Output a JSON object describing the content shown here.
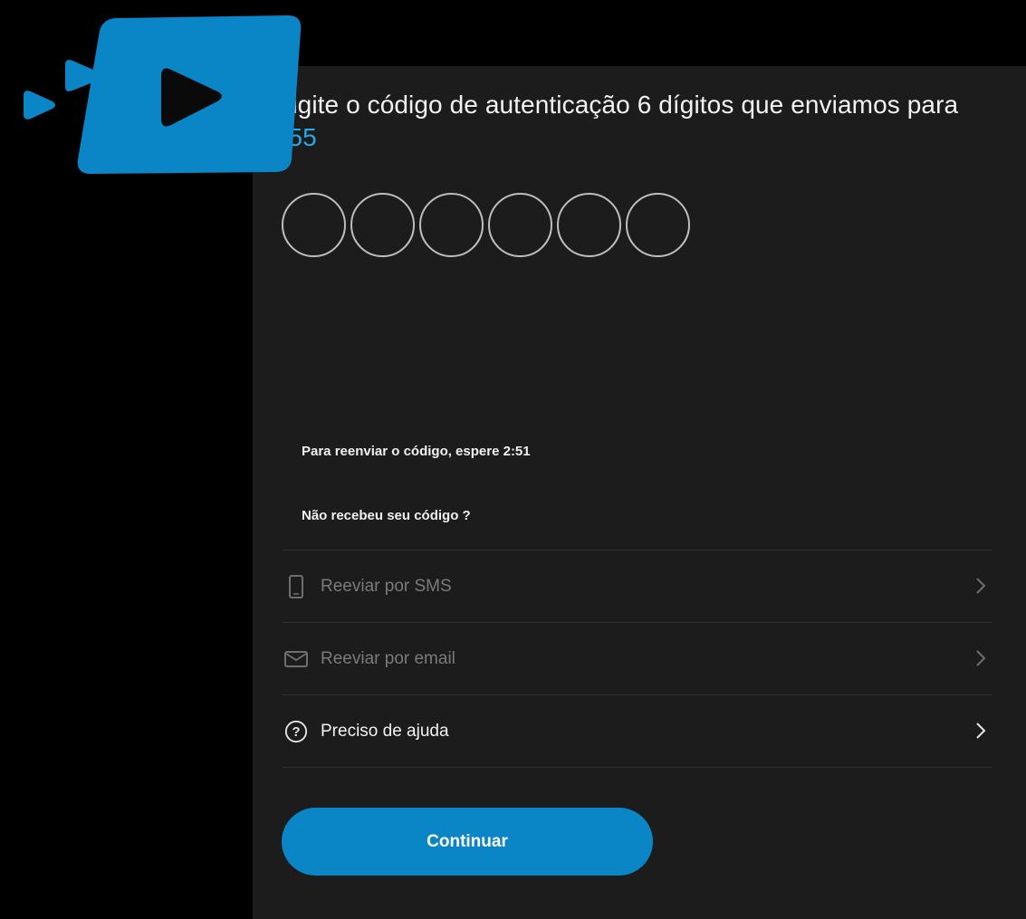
{
  "header": {
    "instruction_text": "Digite o código de autenticação 6 dígitos que enviamos para",
    "phone_prefix": "+55"
  },
  "code_input": {
    "digit_count": 6,
    "values": [
      "",
      "",
      "",
      "",
      "",
      ""
    ]
  },
  "resend": {
    "wait_label": "Para reenviar o código, espere 2:51",
    "not_received_label": "Não recebeu seu código ?"
  },
  "options": [
    {
      "label": "Reeviar por SMS",
      "icon": "phone-icon",
      "enabled": false
    },
    {
      "label": "Reeviar por email",
      "icon": "envelope-icon",
      "enabled": false
    },
    {
      "label": "Preciso de ajuda",
      "icon": "question-circle-icon",
      "enabled": true
    }
  ],
  "actions": {
    "continue_label": "Continuar"
  },
  "colors": {
    "accent": "#0a86c6",
    "phone_highlight": "#2aa6e0",
    "logo_blue": "#0a86c6",
    "panel_bg": "#1c1c1c",
    "page_bg": "#000000"
  }
}
